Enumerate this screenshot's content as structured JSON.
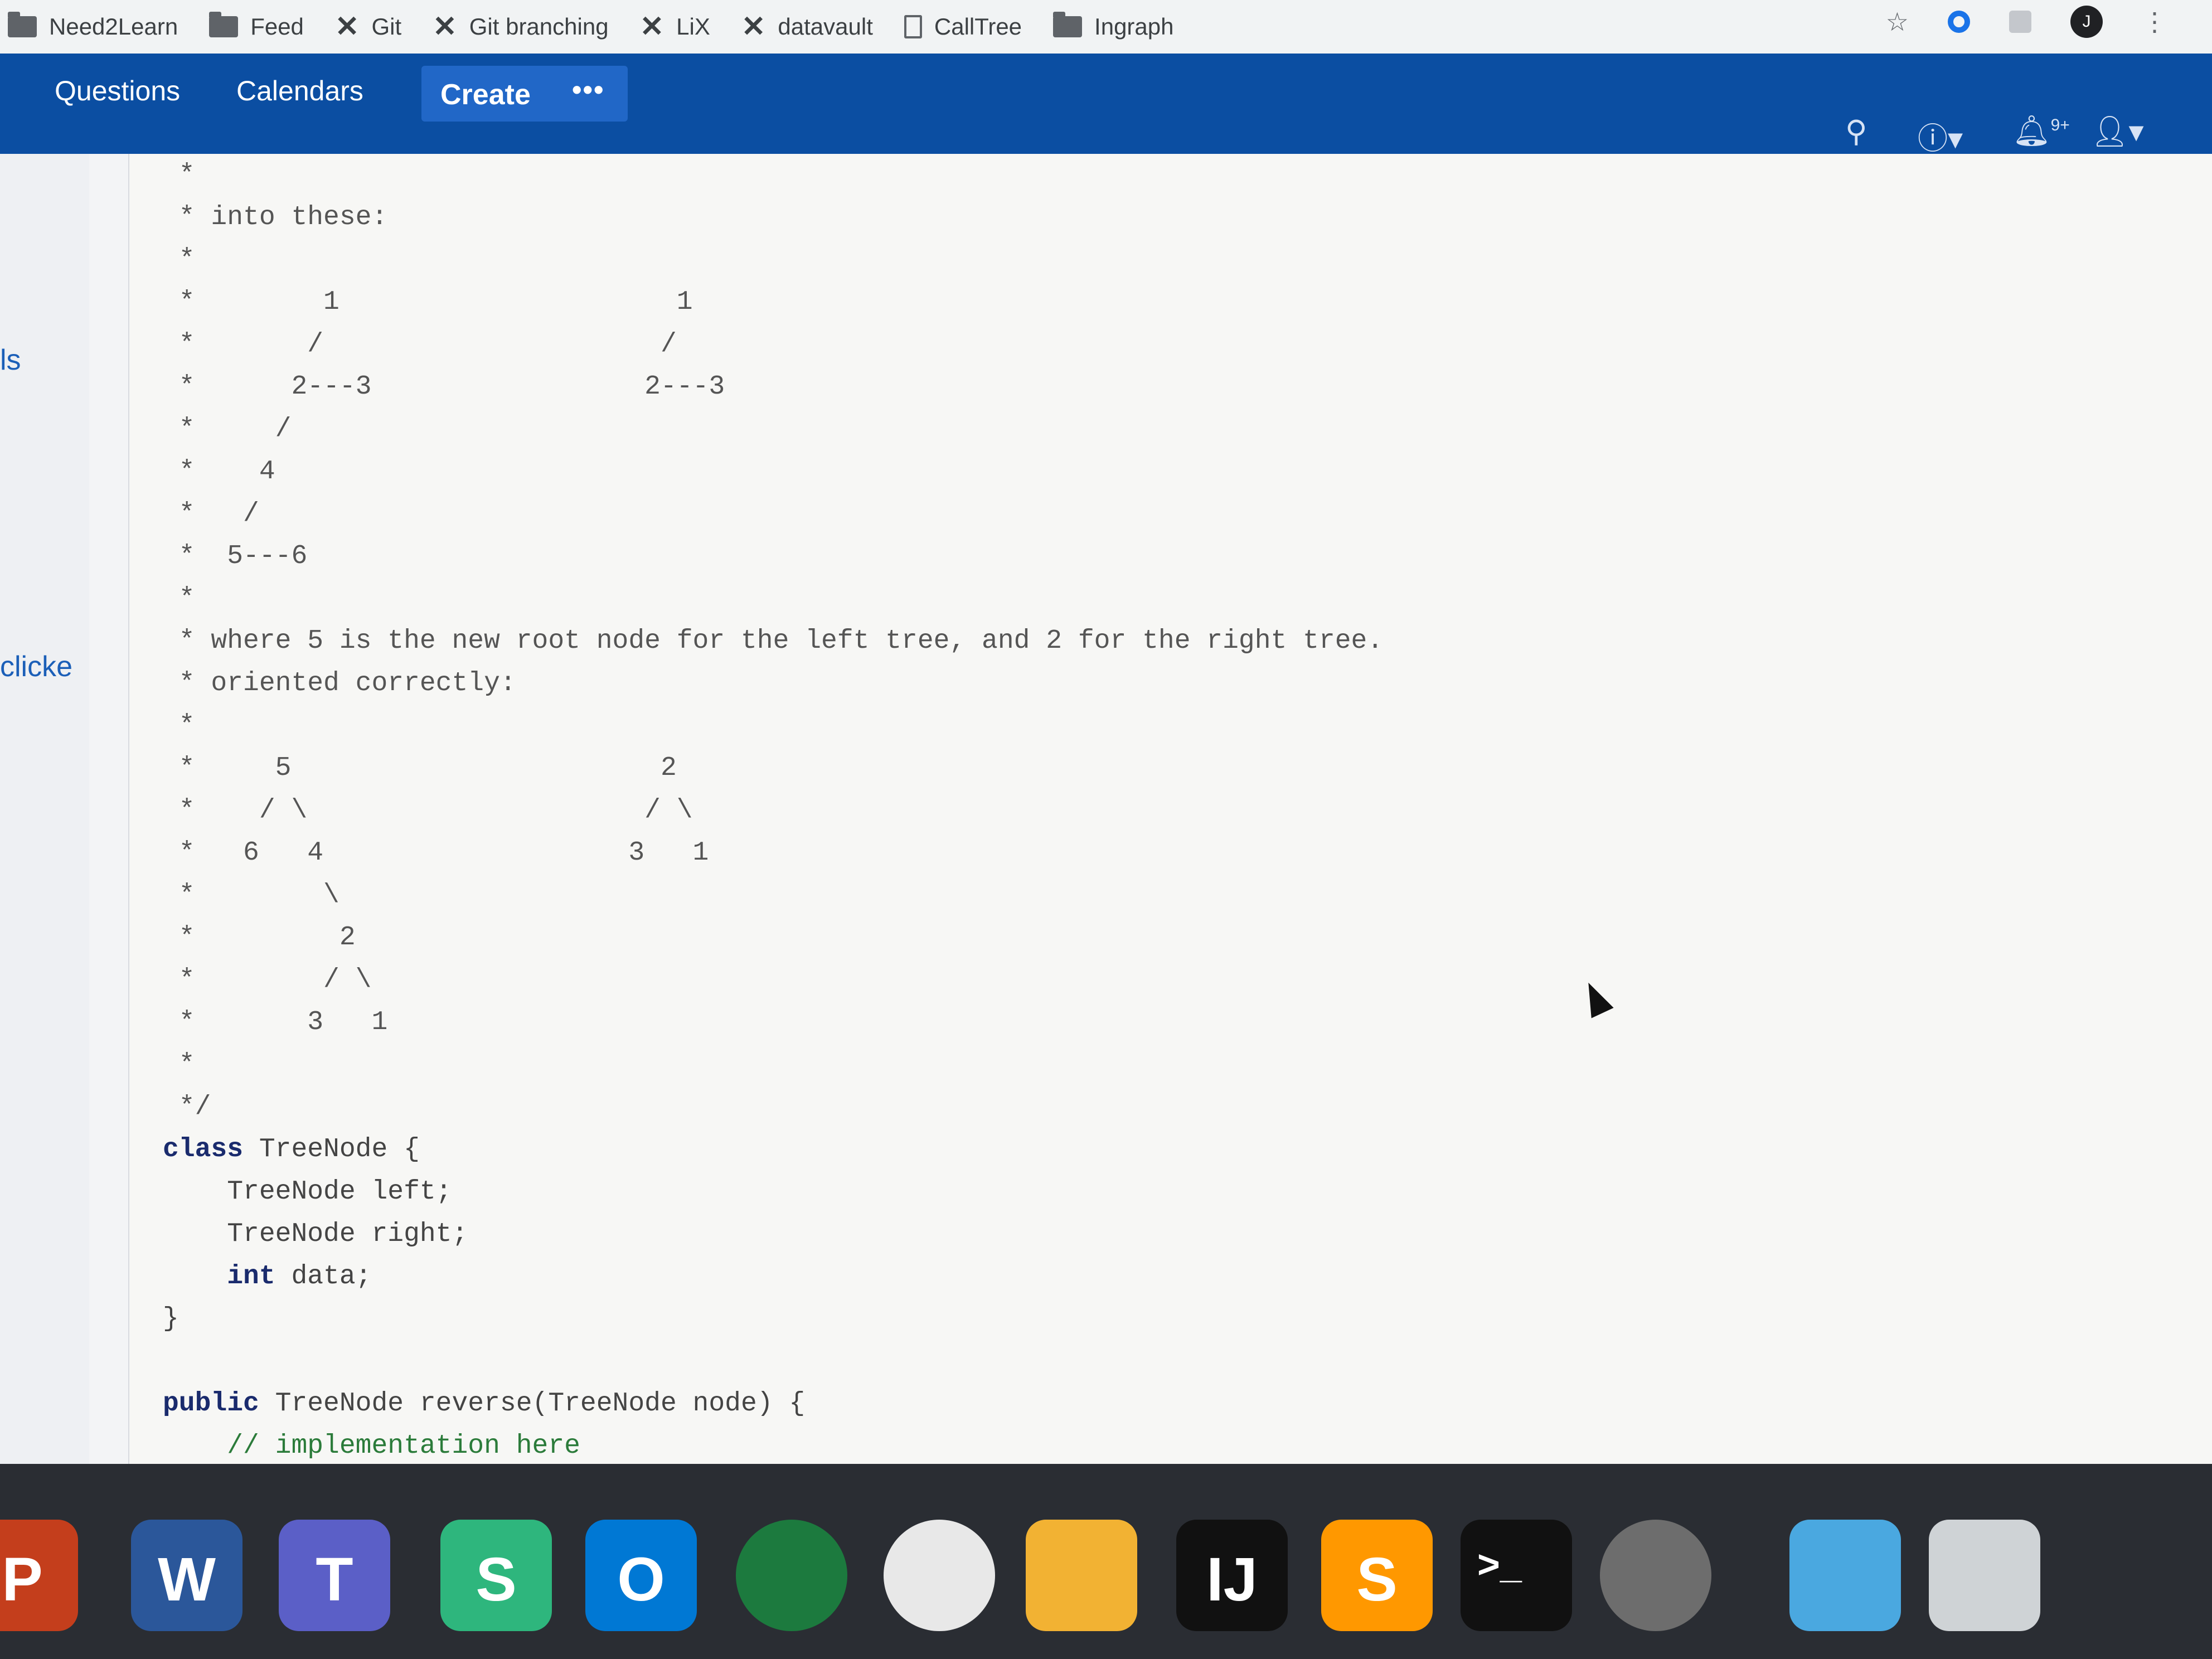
{
  "bookmarks": {
    "items": [
      {
        "label": "Need2Learn",
        "icon": "folder-icon"
      },
      {
        "label": "Feed",
        "icon": "folder-icon"
      },
      {
        "label": "Git",
        "icon": "linkedin-x-icon"
      },
      {
        "label": "Git branching",
        "icon": "linkedin-x-icon"
      },
      {
        "label": "LiX",
        "icon": "linkedin-x-icon"
      },
      {
        "label": "datavault",
        "icon": "linkedin-x-icon"
      },
      {
        "label": "CallTree",
        "icon": "page-icon"
      },
      {
        "label": "Ingraph",
        "icon": "folder-icon"
      }
    ],
    "profile_initial": "J"
  },
  "header": {
    "nav": [
      "Questions",
      "Calendars"
    ],
    "create_label": "Create",
    "more_label": "•••",
    "notification_badge": "9+",
    "accent_color": "#0b4ea2"
  },
  "left_panel": {
    "clipped_text_1": "ls",
    "clipped_text_2": "clicke"
  },
  "code": {
    "lines": [
      " *",
      " * into these:",
      " *",
      " *        1                     1",
      " *       /                     /",
      " *      2---3                 2---3",
      " *     /",
      " *    4",
      " *   /",
      " *  5---6",
      " *",
      " * where 5 is the new root node for the left tree, and 2 for the right tree.",
      " * oriented correctly:",
      " *",
      " *     5                       2",
      " *    / \\                     / \\",
      " *   6   4                   3   1",
      " *        \\",
      " *         2",
      " *        / \\",
      " *       3   1",
      " *",
      " */"
    ],
    "class_kw": "class",
    "class_decl": " TreeNode {",
    "field_left": "    TreeNode left;",
    "field_right": "    TreeNode right;",
    "int_kw": "int",
    "field_data": " data;",
    "class_close": "}",
    "public_kw": "public",
    "method_sig": " TreeNode reverse(TreeNode node) {",
    "comment": "// implementation here",
    "method_close": "}"
  },
  "dock": {
    "apps": [
      {
        "name": "PowerPoint",
        "letter": "P",
        "color": "#c43e1c"
      },
      {
        "name": "Word",
        "letter": "W",
        "color": "#2b579a"
      },
      {
        "name": "Teams",
        "letter": "T",
        "color": "#5b5fc7"
      },
      {
        "name": "Slack",
        "letter": "S",
        "color": "#2eb67d"
      },
      {
        "name": "Outlook",
        "letter": "O",
        "color": "#0078d4"
      },
      {
        "name": "VPN",
        "letter": "",
        "color": "#1c7a3e"
      },
      {
        "name": "Wi-Fi",
        "letter": "",
        "color": "#e8e8e8"
      },
      {
        "name": "Self Service",
        "letter": "",
        "color": "#f2b233"
      },
      {
        "name": "IntelliJ",
        "letter": "IJ",
        "color": "#111111"
      },
      {
        "name": "Sublime Text",
        "letter": "S",
        "color": "#ff9800"
      },
      {
        "name": "Terminal",
        "letter": ">_",
        "color": "#111111"
      },
      {
        "name": "System Preferences",
        "letter": "",
        "color": "#6d6d6d"
      },
      {
        "name": "Downloads",
        "letter": "",
        "color": "#4aa8e0"
      },
      {
        "name": "Trash",
        "letter": "",
        "color": "#cfd3d6"
      }
    ]
  }
}
